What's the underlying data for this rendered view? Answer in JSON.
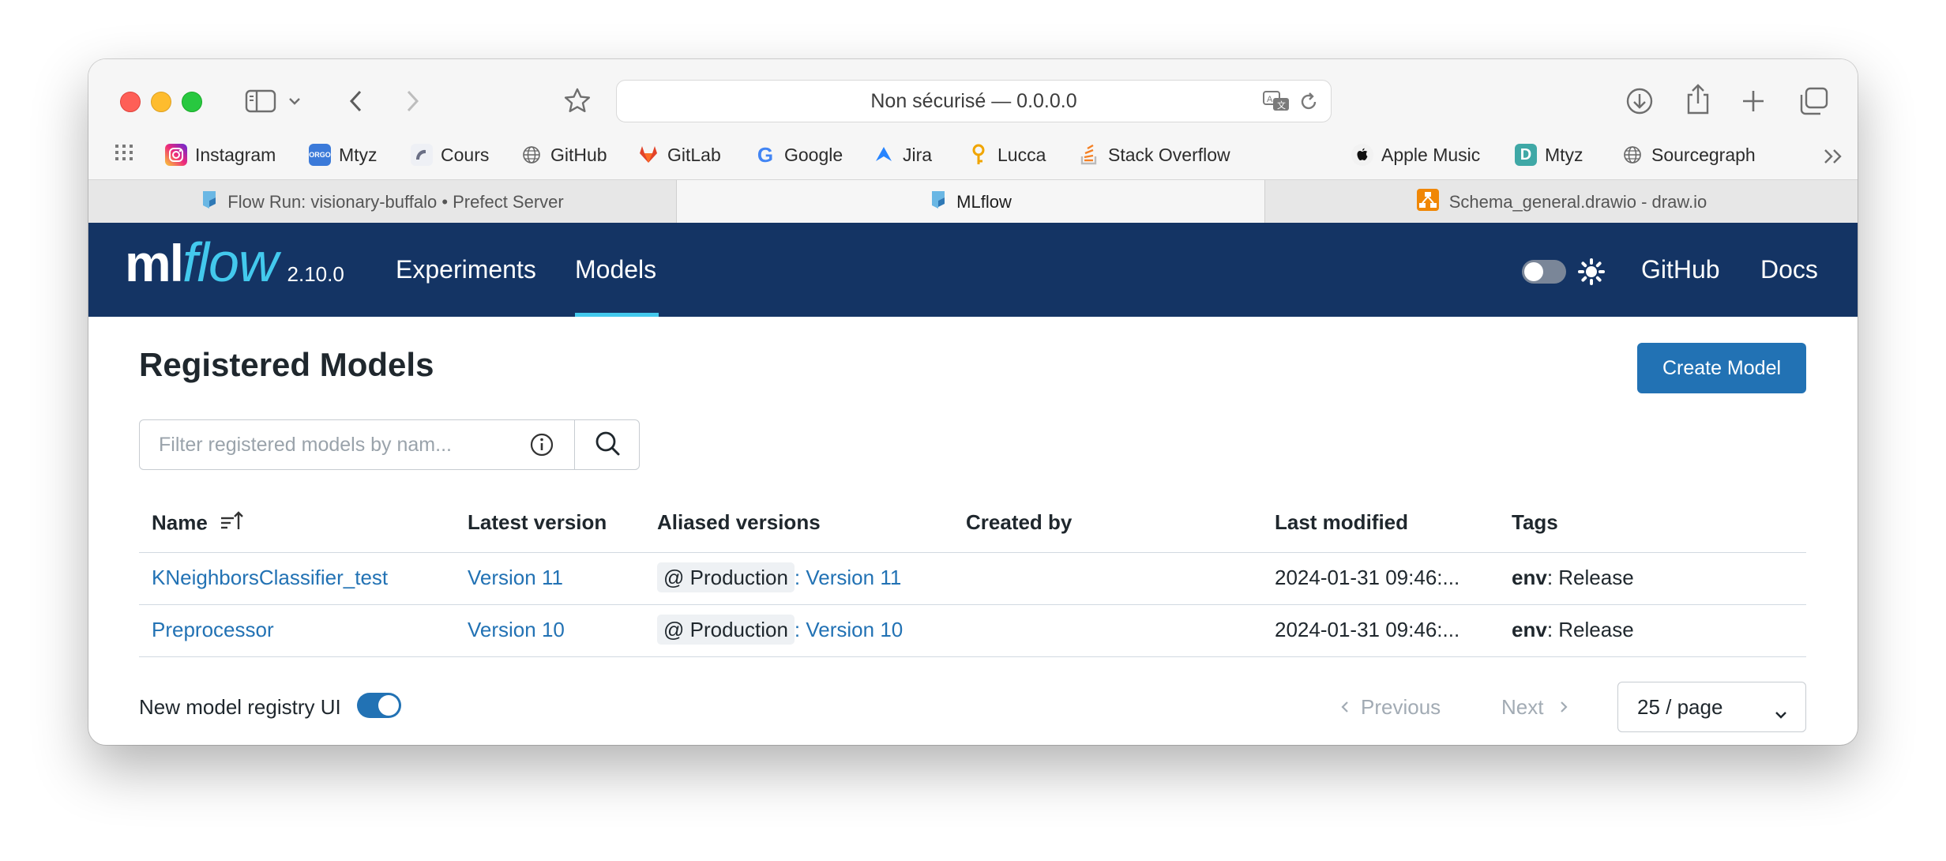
{
  "browser": {
    "address_text": "Non sécurisé — 0.0.0.0",
    "bookmarks": [
      {
        "label": "Instagram",
        "icon": "instagram-icon",
        "color": "#d6249f"
      },
      {
        "label": "Mtyz",
        "icon": "orgo-icon",
        "color": "#3b7ad9"
      },
      {
        "label": "Cours",
        "icon": "cours-icon",
        "color": "#8a8fa0"
      },
      {
        "label": "GitHub",
        "icon": "globe-icon",
        "color": "#555555"
      },
      {
        "label": "GitLab",
        "icon": "gitlab-icon",
        "color": "#e24329"
      },
      {
        "label": "Google",
        "icon": "google-icon",
        "color": "#4285f4"
      },
      {
        "label": "Jira",
        "icon": "jira-icon",
        "color": "#2684ff"
      },
      {
        "label": "Lucca",
        "icon": "lucca-icon",
        "color": "#f0a500"
      },
      {
        "label": "Stack Overflow",
        "icon": "stackoverflow-icon",
        "color": "#f48024"
      },
      {
        "label": "Apple Music",
        "icon": "apple-icon",
        "color": "#000000"
      },
      {
        "label": "Mtyz",
        "icon": "d-icon",
        "color": "#3fa8a6"
      },
      {
        "label": "Sourcegraph",
        "icon": "globe-icon",
        "color": "#555555"
      }
    ],
    "tabs": [
      {
        "label": "Flow Run: visionary-buffalo • Prefect Server",
        "active": false
      },
      {
        "label": "MLflow",
        "active": true
      },
      {
        "label": "Schema_general.drawio - draw.io",
        "active": false
      }
    ]
  },
  "header": {
    "logo_ml": "ml",
    "logo_flow": "flow",
    "version": "2.10.0",
    "nav": [
      "Experiments",
      "Models"
    ],
    "active_nav": "Models",
    "links": [
      "GitHub",
      "Docs"
    ]
  },
  "main": {
    "title": "Registered Models",
    "create_button": "Create Model",
    "search_placeholder": "Filter registered models by nam...",
    "columns": [
      "Name",
      "Latest version",
      "Aliased versions",
      "Created by",
      "Last modified",
      "Tags"
    ],
    "rows": [
      {
        "name": "KNeighborsClassifier_test",
        "latest_version": "Version 11",
        "alias": "@ Production",
        "alias_version": ": Version 11",
        "created_by": "",
        "last_modified": "2024-01-31 09:46:...",
        "tag_key": "env",
        "tag_value": ": Release"
      },
      {
        "name": "Preprocessor",
        "latest_version": "Version 10",
        "alias": "@ Production",
        "alias_version": ": Version 10",
        "created_by": "",
        "last_modified": "2024-01-31 09:46:...",
        "tag_key": "env",
        "tag_value": ": Release"
      }
    ],
    "registry_toggle_label": "New model registry UI",
    "pagination": {
      "previous": "Previous",
      "next": "Next",
      "page_size": "25 / page"
    }
  },
  "colors": {
    "header_bg": "#143464",
    "accent": "#2272b4",
    "logo_flow": "#43c9ed"
  }
}
